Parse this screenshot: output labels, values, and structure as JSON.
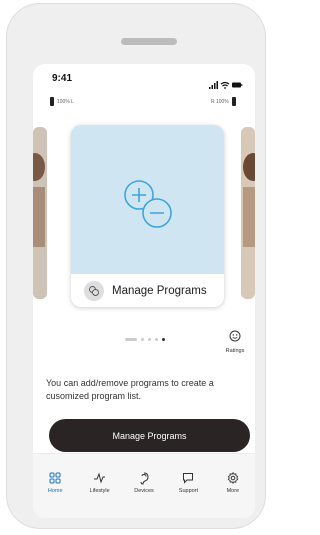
{
  "status": {
    "time": "9:41",
    "left_battery": "100%  L",
    "right_battery": "R  100%"
  },
  "card": {
    "label": "Manage Programs",
    "image_icon": "add-remove-icon",
    "label_icon": "programs-icon"
  },
  "ratings": {
    "label": "Ratings",
    "icon": "smiley-icon"
  },
  "description": "You can add/remove programs to create a cusomized program list.",
  "button": {
    "label": "Manage Programs"
  },
  "tabs": [
    {
      "label": "Home",
      "icon": "home-grid-icon",
      "active": true
    },
    {
      "label": "Lifestyle",
      "icon": "lifestyle-icon",
      "active": false
    },
    {
      "label": "Devices",
      "icon": "devices-icon",
      "active": false
    },
    {
      "label": "Support",
      "icon": "support-icon",
      "active": false
    },
    {
      "label": "More",
      "icon": "settings-icon",
      "active": false
    }
  ],
  "colors": {
    "accent": "#1a73c4",
    "button_bg": "#2a2424",
    "card_image_bg": "#cfe6f2",
    "icon_blue": "#3aa6e0"
  }
}
